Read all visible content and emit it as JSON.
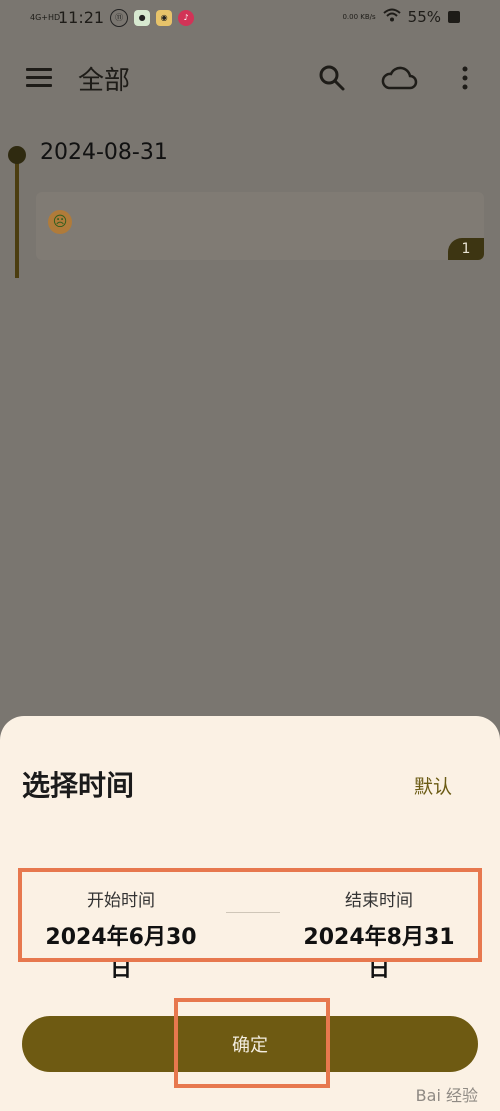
{
  "status_bar": {
    "network": "4G+HD",
    "time": "11:21",
    "speed": "0.00 KB/s",
    "battery": "55%",
    "notification_icons": [
      "11-app-icon",
      "wechat-icon",
      "weibo-icon",
      "tiktok-icon"
    ]
  },
  "app_bar": {
    "title": "全部",
    "icons": [
      "menu-icon",
      "search-icon",
      "cloud-icon",
      "more-icon"
    ]
  },
  "timeline": {
    "date": "2024-08-31",
    "entry_count": "1",
    "entry_emoji": "sick-face-emoji"
  },
  "sheet": {
    "title": "选择时间",
    "default_label": "默认",
    "start_label": "开始时间",
    "start_value": "2024年6月30日",
    "end_label": "结束时间",
    "end_value": "2024年8月31日",
    "confirm_label": "确定"
  },
  "watermark": "Bai 经验",
  "colors": {
    "overlay": "#7a7670",
    "sheet_bg": "#fbf1e4",
    "accent": "#6e5a12",
    "highlight": "#e7784e"
  }
}
